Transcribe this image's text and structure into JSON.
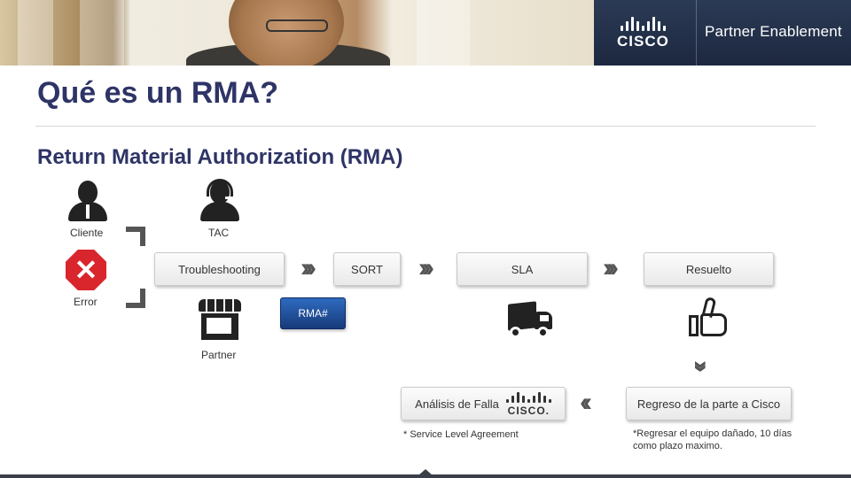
{
  "header": {
    "brand_logo": "Cisco",
    "program": "Partner Enablement"
  },
  "slide": {
    "title": "Qué es un RMA?",
    "subtitle": "Return Material Authorization (RMA)"
  },
  "actors": {
    "cliente": "Cliente",
    "tac": "TAC",
    "error": "Error",
    "partner": "Partner"
  },
  "icons": {
    "error": "error-x-icon",
    "store": "store-icon",
    "truck": "truck-icon",
    "thumb": "thumbs-up-icon"
  },
  "process": {
    "troubleshooting": "Troubleshooting",
    "sort": "SORT",
    "sla": "SLA",
    "resuelto": "Resuelto",
    "rma_badge": "RMA#",
    "regreso": "Regreso de la parte a Cisco",
    "analisis": "Análisis de Falla",
    "analisis_logo": "cisco."
  },
  "notes": {
    "sla_note": "* Service Level Agreement",
    "return_note": "*Regresar el equipo dañado, 10 días como plazo maximo."
  },
  "colors": {
    "title": "#2e3466",
    "error": "#d8262c",
    "rma_badge": "#1f4d9e",
    "header_brand_bg": "#2b3a55"
  }
}
